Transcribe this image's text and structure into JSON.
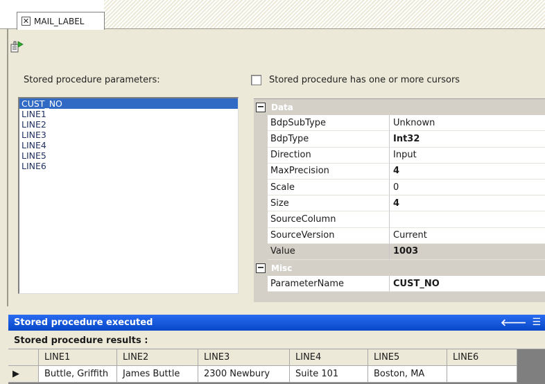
{
  "tab": {
    "close_glyph": "✕",
    "label": "MAIL_LABEL"
  },
  "toolbar": {
    "execute_icon": "execute-procedure-icon"
  },
  "parameters": {
    "label": "Stored procedure parameters:",
    "items": [
      "CUST_NO",
      "LINE1",
      "LINE2",
      "LINE3",
      "LINE4",
      "LINE5",
      "LINE6"
    ],
    "selected_index": 0
  },
  "cursor_option": {
    "label": "Stored procedure has one or more cursors",
    "checked": false
  },
  "property_grid": {
    "collapse_glyph": "⊟",
    "categories": [
      {
        "name": "Data",
        "properties": [
          {
            "name": "BdpSubType",
            "value": "Unknown",
            "bold": false
          },
          {
            "name": "BdpType",
            "value": "Int32",
            "bold": true
          },
          {
            "name": "Direction",
            "value": "Input",
            "bold": false
          },
          {
            "name": "MaxPrecision",
            "value": "4",
            "bold": true
          },
          {
            "name": "Scale",
            "value": "0",
            "bold": false
          },
          {
            "name": "Size",
            "value": "4",
            "bold": true
          },
          {
            "name": "SourceColumn",
            "value": "",
            "bold": false
          },
          {
            "name": "SourceVersion",
            "value": "Current",
            "bold": false
          },
          {
            "name": "Value",
            "value": "1003",
            "bold": true,
            "highlighted": true
          }
        ]
      },
      {
        "name": "Misc",
        "properties": [
          {
            "name": "ParameterName",
            "value": "CUST_NO",
            "bold": true
          }
        ]
      }
    ]
  },
  "status": {
    "executed_text": "Stored procedure executed",
    "results_label": "Stored procedure results :"
  },
  "results": {
    "row_indicator": "▶",
    "columns": [
      "LINE1",
      "LINE2",
      "LINE3",
      "LINE4",
      "LINE5",
      "LINE6"
    ],
    "rows": [
      [
        "Buttle, Griffith",
        "James Buttle",
        "2300 Newbury",
        "Suite 101",
        "Boston, MA",
        ""
      ]
    ]
  },
  "colors": {
    "selection": "#316ac5",
    "status_bar": "#0a4fd6",
    "panel_bg": "#ece9d8",
    "grid_bg": "#d4d0c8"
  }
}
